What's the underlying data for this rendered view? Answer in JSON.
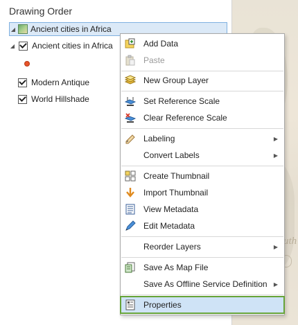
{
  "pane": {
    "title": "Drawing Order"
  },
  "tree": {
    "map_name": "Ancient cities in Africa",
    "layers": [
      {
        "label": "Ancient cities in Africa"
      },
      {
        "label": "Modern Antique"
      },
      {
        "label": "World Hillshade"
      }
    ]
  },
  "menu": {
    "add_data": "Add Data",
    "paste": "Paste",
    "new_group_layer": "New Group Layer",
    "set_reference_scale": "Set Reference Scale",
    "clear_reference_scale": "Clear Reference Scale",
    "labeling": "Labeling",
    "convert_labels": "Convert Labels",
    "create_thumbnail": "Create Thumbnail",
    "import_thumbnail": "Import Thumbnail",
    "view_metadata": "View Metadata",
    "edit_metadata": "Edit Metadata",
    "reorder_layers": "Reorder Layers",
    "save_as_map_file": "Save As Map File",
    "save_as_offline": "Save As Offline Service Definition",
    "properties": "Properties"
  },
  "map_fragment_text": "uth"
}
